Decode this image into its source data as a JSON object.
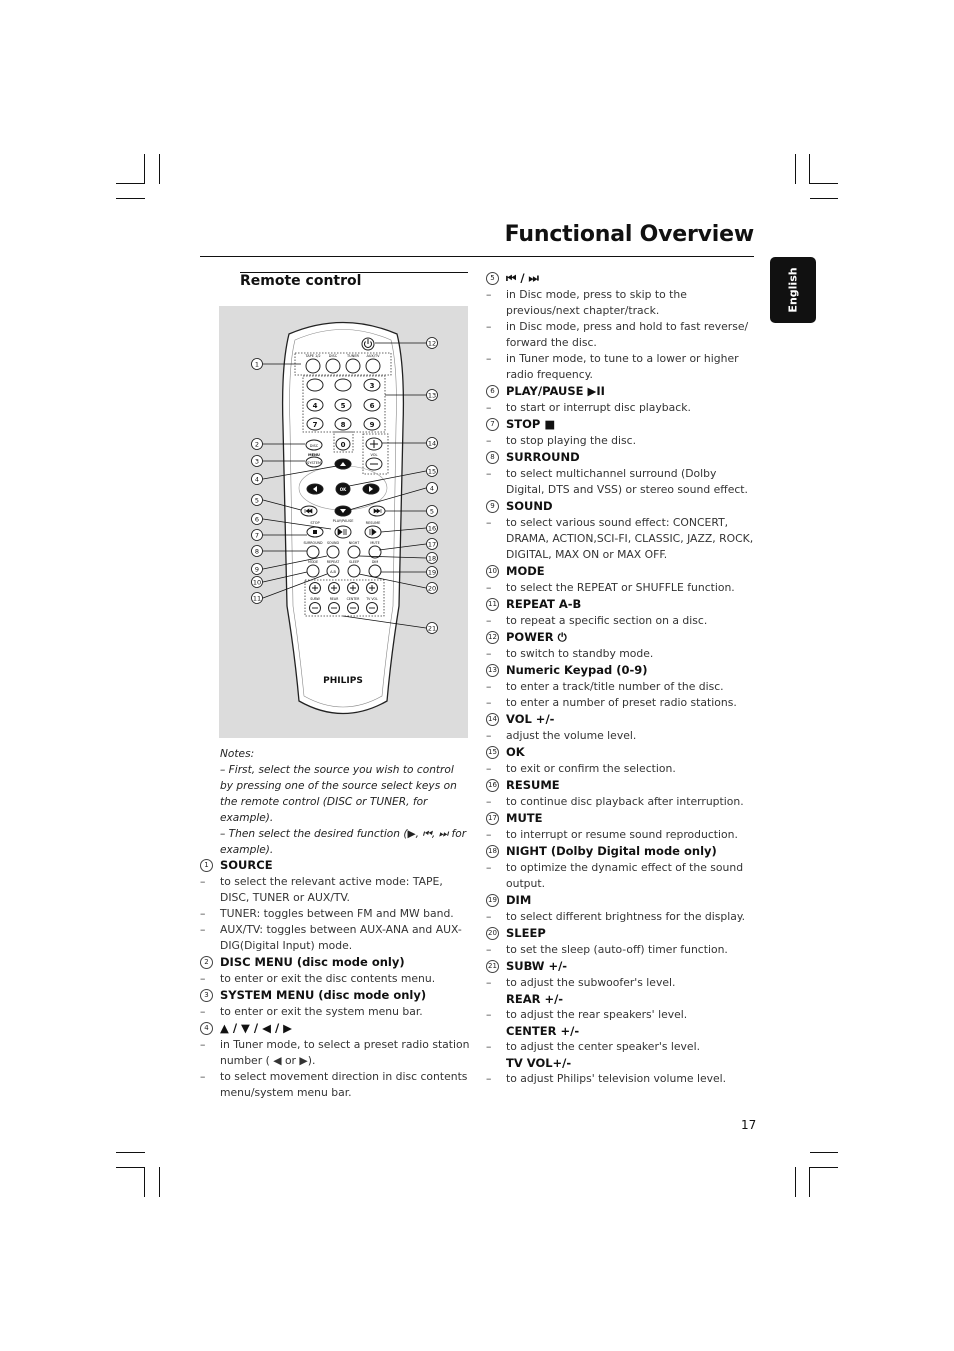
{
  "page": {
    "title": "Functional Overview",
    "language_tab": "English",
    "page_number": "17"
  },
  "section": {
    "title": "Remote control"
  },
  "figure": {
    "brand": "PHILIPS",
    "source_labels": [
      "TAPE 1/2",
      "DISC",
      "TUNER",
      "AUX/TV"
    ],
    "keypad": [
      "",
      "",
      "3",
      "4",
      "5",
      "6",
      "7",
      "8",
      "9",
      "0"
    ],
    "disc_label": "DISC",
    "menu_label": "MENU",
    "system_label": "SYSTEM",
    "vol_label": "VOL",
    "ok_label": "OK",
    "stop_label": "STOP",
    "playpause_label": "PLAY/PAUSE",
    "resume_label": "RESUME",
    "row_labels_1": [
      "SURROUND",
      "SOUND",
      "NIGHT",
      "MUTE"
    ],
    "row_labels_2": [
      "MODE",
      "REPEAT",
      "SLEEP",
      "DIM"
    ],
    "ab_label": "A-B",
    "level_labels": [
      "SUBW",
      "REAR",
      "CENTER",
      "TV VOL"
    ],
    "callouts_left": [
      "1",
      "2",
      "3",
      "4",
      "5",
      "6",
      "7",
      "8",
      "9",
      "10",
      "11"
    ],
    "callouts_right": [
      "12",
      "13",
      "14",
      "15",
      "4",
      "5",
      "16",
      "17",
      "18",
      "19",
      "20",
      "21"
    ]
  },
  "notes": {
    "heading": "Notes:",
    "lines": [
      "–  First, select the source you wish to control by pressing one of the source select keys on the remote control (DISC or TUNER, for example).",
      "–  Then select the desired function (▶,  ⏮, ⏭ for example)."
    ]
  },
  "left_items": [
    {
      "num": "1",
      "title": "SOURCE",
      "desc": [
        "to select the relevant active mode: TAPE, DISC, TUNER or AUX/TV.",
        "TUNER: toggles between FM and MW band.",
        "AUX/TV: toggles between AUX-ANA and AUX-DIG(Digital Input) mode."
      ]
    },
    {
      "num": "2",
      "title": "DISC MENU (disc mode only)",
      "desc": [
        "to enter or exit the disc contents menu."
      ]
    },
    {
      "num": "3",
      "title": "SYSTEM MENU (disc mode only)",
      "desc": [
        "to enter or exit the system menu bar."
      ]
    },
    {
      "num": "4",
      "title": "▲ / ▼ / ◀ / ▶",
      "desc": [
        "in Tuner mode, to select a preset radio station number ( ◀ or ▶).",
        "to select movement direction in disc contents menu/system menu bar."
      ]
    }
  ],
  "right_items": [
    {
      "num": "5",
      "title": "⏮ / ⏭",
      "desc": [
        "in Disc mode, press to skip to the previous/next chapter/track.",
        "in Disc mode, press and hold to fast reverse/ forward the disc.",
        "in Tuner mode, to tune to a lower or higher radio frequency."
      ]
    },
    {
      "num": "6",
      "title": "PLAY/PAUSE ▶II",
      "desc": [
        "to start or interrupt disc playback."
      ]
    },
    {
      "num": "7",
      "title": "STOP ■",
      "desc": [
        "to stop playing the disc."
      ]
    },
    {
      "num": "8",
      "title": "SURROUND",
      "desc": [
        "to select multichannel surround (Dolby Digital, DTS and VSS) or stereo sound effect."
      ]
    },
    {
      "num": "9",
      "title": "SOUND",
      "desc": [
        "to select various sound effect: CONCERT, DRAMA, ACTION,SCI-FI, CLASSIC, JAZZ, ROCK, DIGITAL, MAX ON or MAX OFF."
      ]
    },
    {
      "num": "10",
      "title": "MODE",
      "desc": [
        "to select the REPEAT or SHUFFLE function."
      ]
    },
    {
      "num": "11",
      "title": "REPEAT A-B",
      "desc": [
        "to repeat a specific section on a disc."
      ]
    },
    {
      "num": "12",
      "title": "POWER ⏻",
      "desc": [
        "to switch to standby mode."
      ]
    },
    {
      "num": "13",
      "title": "Numeric Keypad (0-9)",
      "desc": [
        "to enter a track/title number of the disc.",
        "to enter a number of preset radio stations."
      ]
    },
    {
      "num": "14",
      "title": "VOL +/-",
      "desc": [
        "adjust the volume level."
      ]
    },
    {
      "num": "15",
      "title": "OK",
      "desc": [
        "to exit or confirm the selection."
      ]
    },
    {
      "num": "16",
      "title": "RESUME",
      "desc": [
        "to continue disc playback after interruption."
      ]
    },
    {
      "num": "17",
      "title": "MUTE",
      "desc": [
        "to interrupt or resume sound reproduction."
      ]
    },
    {
      "num": "18",
      "title": "NIGHT (Dolby Digital mode only)",
      "desc": [
        "to optimize the dynamic effect of the sound output."
      ]
    },
    {
      "num": "19",
      "title": "DIM",
      "desc": [
        "to select different brightness for the display."
      ]
    },
    {
      "num": "20",
      "title": "SLEEP",
      "desc": [
        "to set the sleep (auto-off) timer function."
      ]
    },
    {
      "num": "21",
      "title": "SUBW +/-",
      "desc": [
        "to adjust the subwoofer's level."
      ],
      "extra": [
        {
          "title": "REAR +/-",
          "desc": "to adjust the rear speakers' level."
        },
        {
          "title": "CENTER +/-",
          "desc": "to adjust the center speaker's level."
        },
        {
          "title": "TV VOL+/-",
          "desc": "to adjust Philips' television volume level."
        }
      ]
    }
  ]
}
